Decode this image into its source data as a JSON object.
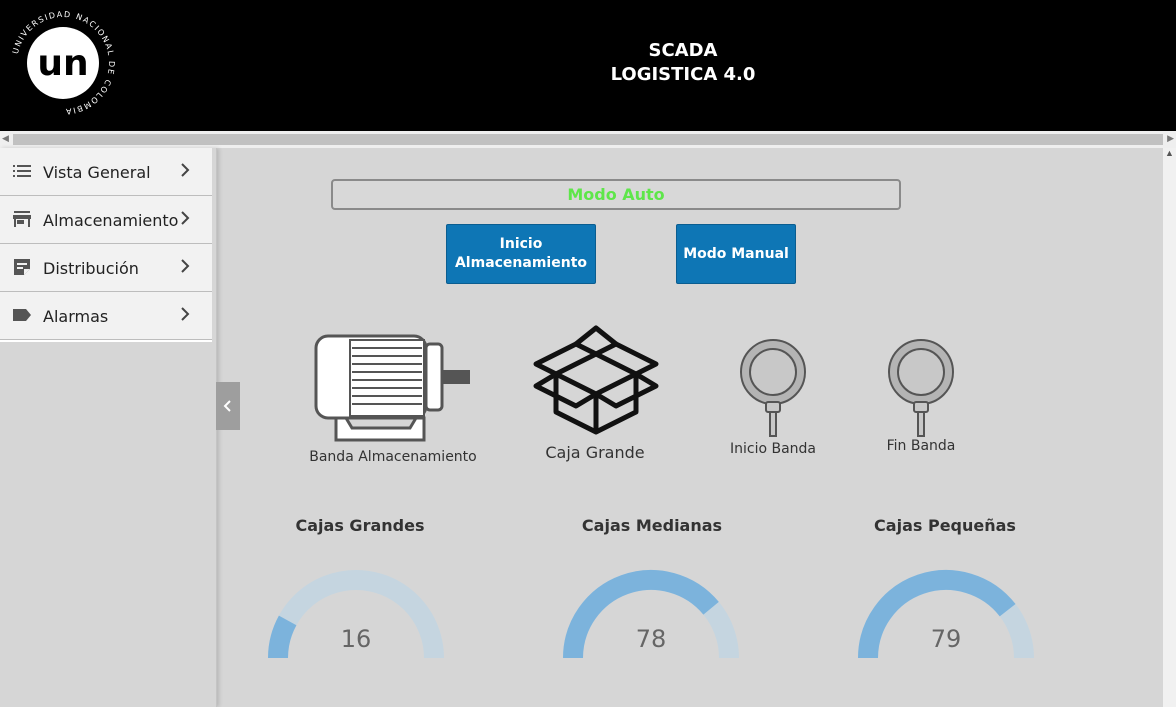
{
  "header": {
    "title_line1": "SCADA",
    "title_line2": "LOGISTICA 4.0",
    "logo_text": "UNIVERSIDAD NACIONAL DE COLOMBIA",
    "logo_mark": "un"
  },
  "sidebar": {
    "items": [
      {
        "label": "Vista General",
        "icon": "list-icon"
      },
      {
        "label": "Almacenamiento",
        "icon": "store-icon"
      },
      {
        "label": "Distribución",
        "icon": "note-icon"
      },
      {
        "label": "Alarmas",
        "icon": "label-icon"
      }
    ]
  },
  "status": {
    "mode_label": "Modo Auto",
    "mode_color": "#5ee64a"
  },
  "buttons": {
    "inicio_line1": "Inicio",
    "inicio_line2": "Almacenamiento",
    "manual": "Modo Manual",
    "color": "#0e76b5"
  },
  "symbols": {
    "motor": "Banda Almacenamiento",
    "box": "Caja Grande",
    "sensor_start": "Inicio Banda",
    "sensor_end": "Fin Banda"
  },
  "gauges": [
    {
      "title": "Cajas Grandes",
      "value": 16,
      "max": 100
    },
    {
      "title": "Cajas Medianas",
      "value": 78,
      "max": 100
    },
    {
      "title": "Cajas Pequeñas",
      "value": 79,
      "max": 100
    }
  ],
  "colors": {
    "gauge_fill": "#7cb3dc",
    "gauge_track": "#c5d5e0",
    "header_bg": "#000000"
  }
}
